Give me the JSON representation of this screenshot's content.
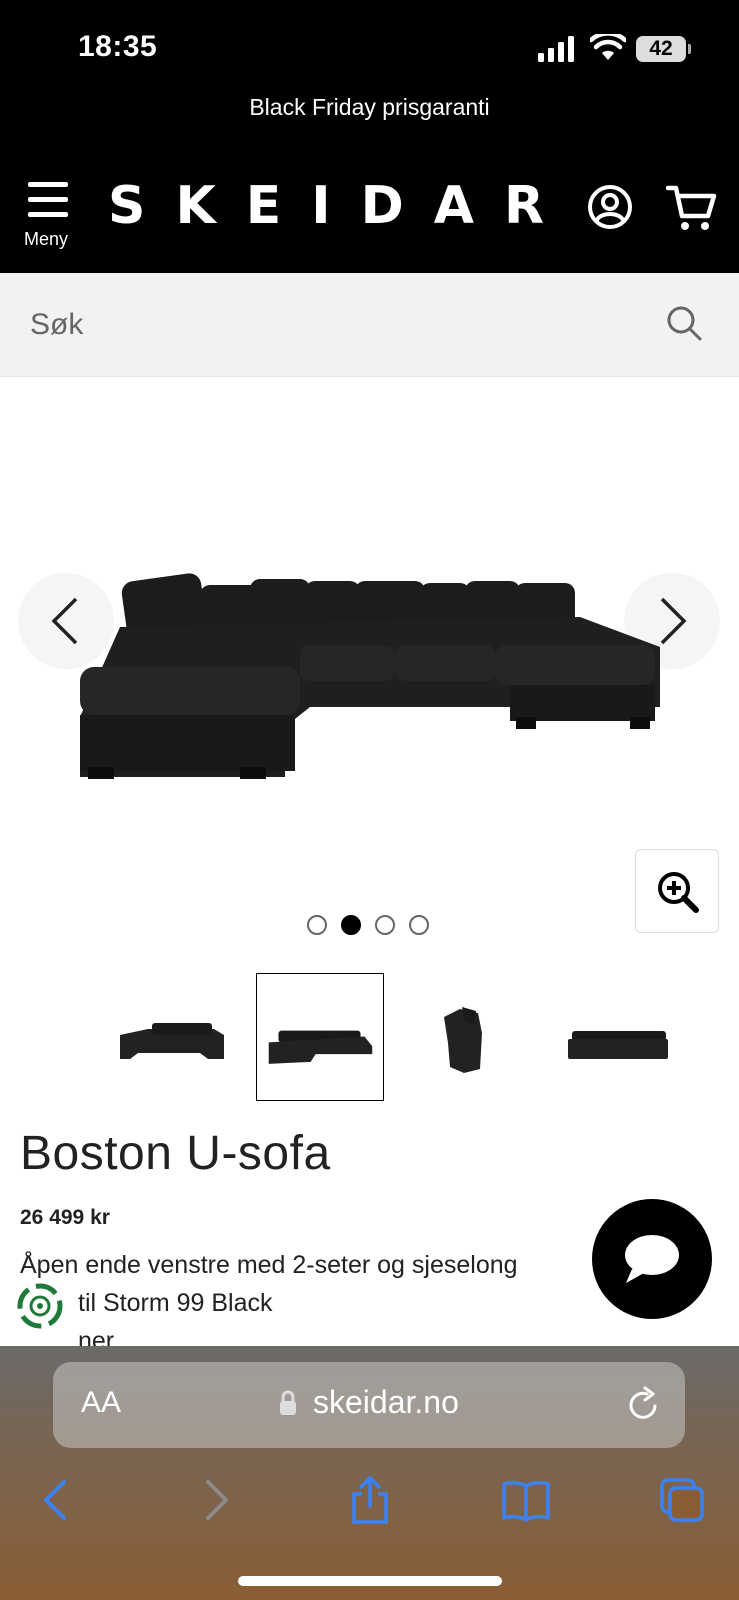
{
  "status_bar": {
    "time": "18:35",
    "battery": "42"
  },
  "promo": {
    "text": "Black Friday prisgaranti"
  },
  "header": {
    "menu_label": "Meny",
    "logo": "SKEIDAR"
  },
  "search": {
    "placeholder": "Søk"
  },
  "gallery": {
    "current_index": 2,
    "total_images": 4,
    "thumbnails": [
      "sofa-front-view",
      "sofa-angled-view",
      "sofa-side-view",
      "sofa-back-view"
    ]
  },
  "product": {
    "title": "Boston U-sofa",
    "price": "26 499 kr",
    "description_line1": "Åpen ende venstre med 2-seter og sjeselong",
    "description_line2": "til Storm 99 Black",
    "description_line3": "ner"
  },
  "browser": {
    "domain": "skeidar.no",
    "text_size_label": "AA"
  },
  "colors": {
    "header_bg": "#000000",
    "search_bg": "#f2f2f2",
    "ios_blue": "#3b82f6"
  }
}
